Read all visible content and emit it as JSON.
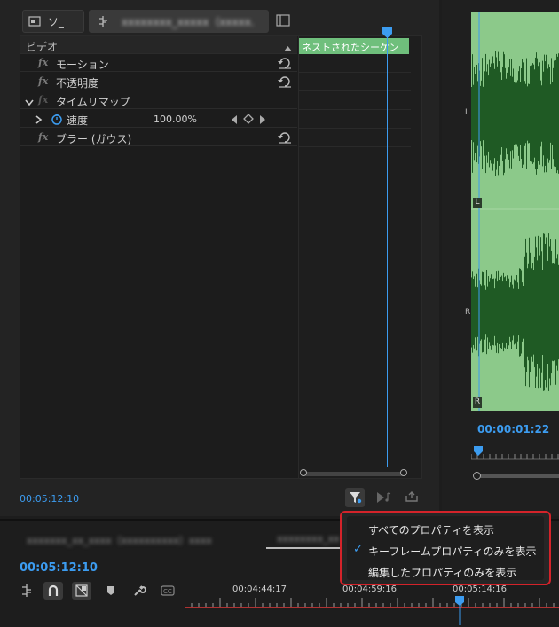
{
  "effect_controls": {
    "tabs": {
      "source_label": "ソ_",
      "sequence_label": "xxxxxxxx_xxxxx（xxxxx..."
    },
    "rows": {
      "video_header": "ビデオ",
      "motion": "モーション",
      "opacity": "不透明度",
      "time_remap": "タイムリマップ",
      "speed_label": "速度",
      "speed_value": "100.00%",
      "blur": "ブラー (ガウス)"
    },
    "clip_label": "ネストされたシーケン",
    "timecode": "00:05:12:10"
  },
  "audio_preview": {
    "left_channel": "L",
    "right_channel": "R",
    "left_badge": "L",
    "right_badge": "R",
    "timecode": "00:00:01:22"
  },
  "dropdown_menu": {
    "items": [
      {
        "label": "すべてのプロパティを表示",
        "checked": false
      },
      {
        "label": "キーフレームプロパティのみを表示",
        "checked": true
      },
      {
        "label": "編集したプロパティのみを表示",
        "checked": false
      }
    ],
    "check_mark": "✓"
  },
  "timeline": {
    "tab1": "xxxxxxx_xx_xxxx（xxxxxxxxxx）xxxx",
    "tab2": "xxxxxxxx_xx",
    "timecode": "00:05:12:10",
    "ruler_labels": [
      "00:04:44:17",
      "00:04:59:16",
      "00:05:14:16"
    ]
  },
  "colors": {
    "accent_blue": "#3c9cf0",
    "clip_green": "#6fbf7c",
    "waveform_bg": "#8cc98a",
    "waveform_fg": "#1f5a24",
    "menu_border": "#d4232a",
    "playhead_red": "#e03a3a"
  }
}
